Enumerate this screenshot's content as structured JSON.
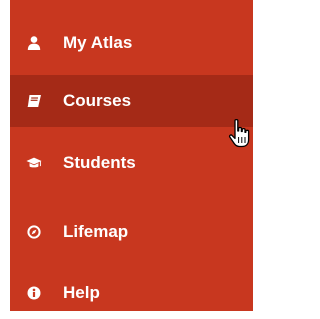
{
  "menu": {
    "active_index": 1,
    "items": [
      {
        "label": "My Atlas",
        "icon": "user-icon"
      },
      {
        "label": "Courses",
        "icon": "book-icon"
      },
      {
        "label": "Students",
        "icon": "graduation-cap-icon"
      },
      {
        "label": "Lifemap",
        "icon": "compass-icon"
      },
      {
        "label": "Help",
        "icon": "info-icon"
      }
    ]
  },
  "colors": {
    "menu_background": "#c8371f",
    "active_background": "#a52a17",
    "text": "#ffffff"
  },
  "cursor": {
    "icon": "hand-pointer-cursor-icon"
  }
}
